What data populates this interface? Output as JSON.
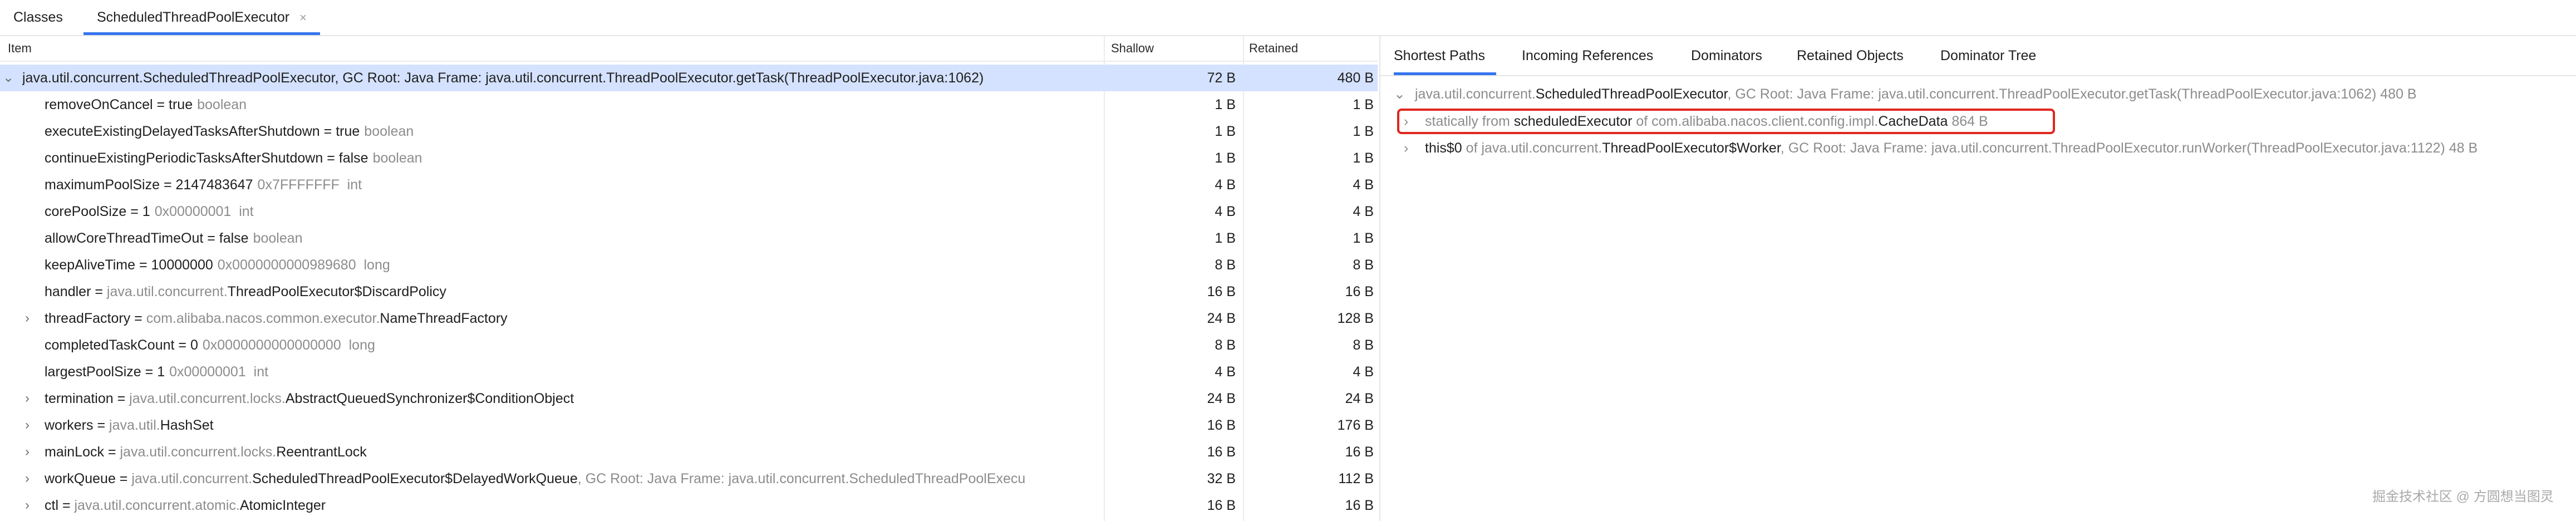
{
  "tabs": [
    {
      "label": "Classes"
    },
    {
      "label": "ScheduledThreadPoolExecutor",
      "close": "×"
    }
  ],
  "table": {
    "headers": {
      "item": "Item",
      "shallow": "Shallow",
      "retained": "Retained"
    }
  },
  "root_row": {
    "chevron": "⌄",
    "text": "java.util.concurrent.ScheduledThreadPoolExecutor, GC Root: Java Frame: java.util.concurrent.ThreadPoolExecutor.getTask(ThreadPoolExecutor.java:1062)",
    "shallow": "72 B",
    "retained": "480 B"
  },
  "fields": [
    {
      "name": "removeOnCancel = true",
      "pkg": "",
      "cls": "",
      "suffix": "boolean",
      "shallow": "1 B",
      "retained": "1 B",
      "expandable": false
    },
    {
      "name": "executeExistingDelayedTasksAfterShutdown = true",
      "pkg": "",
      "cls": "",
      "suffix": "boolean",
      "shallow": "1 B",
      "retained": "1 B",
      "expandable": false
    },
    {
      "name": "continueExistingPeriodicTasksAfterShutdown = false",
      "pkg": "",
      "cls": "",
      "suffix": "boolean",
      "shallow": "1 B",
      "retained": "1 B",
      "expandable": false
    },
    {
      "name": "maximumPoolSize = 2147483647",
      "pkg": "",
      "cls": "",
      "suffix": "0x7FFFFFFF  int",
      "shallow": "4 B",
      "retained": "4 B",
      "expandable": false
    },
    {
      "name": "corePoolSize = 1",
      "pkg": "",
      "cls": "",
      "suffix": "0x00000001  int",
      "shallow": "4 B",
      "retained": "4 B",
      "expandable": false
    },
    {
      "name": "allowCoreThreadTimeOut = false",
      "pkg": "",
      "cls": "",
      "suffix": "boolean",
      "shallow": "1 B",
      "retained": "1 B",
      "expandable": false
    },
    {
      "name": "keepAliveTime = 10000000",
      "pkg": "",
      "cls": "",
      "suffix": "0x0000000000989680  long",
      "shallow": "8 B",
      "retained": "8 B",
      "expandable": false
    },
    {
      "name": "handler = ",
      "pkg": "java.util.concurrent.",
      "cls": "ThreadPoolExecutor$DiscardPolicy",
      "suffix": "",
      "shallow": "16 B",
      "retained": "16 B",
      "expandable": false
    },
    {
      "name": "threadFactory = ",
      "pkg": "com.alibaba.nacos.common.executor.",
      "cls": "NameThreadFactory",
      "suffix": "",
      "shallow": "24 B",
      "retained": "128 B",
      "expandable": true
    },
    {
      "name": "completedTaskCount = 0",
      "pkg": "",
      "cls": "",
      "suffix": "0x0000000000000000  long",
      "shallow": "8 B",
      "retained": "8 B",
      "expandable": false
    },
    {
      "name": "largestPoolSize = 1",
      "pkg": "",
      "cls": "",
      "suffix": "0x00000001  int",
      "shallow": "4 B",
      "retained": "4 B",
      "expandable": false
    },
    {
      "name": "termination = ",
      "pkg": "java.util.concurrent.locks.",
      "cls": "AbstractQueuedSynchronizer$ConditionObject",
      "suffix": "",
      "shallow": "24 B",
      "retained": "24 B",
      "expandable": true
    },
    {
      "name": "workers = ",
      "pkg": "java.util.",
      "cls": "HashSet",
      "suffix": "",
      "shallow": "16 B",
      "retained": "176 B",
      "expandable": true
    },
    {
      "name": "mainLock = ",
      "pkg": "java.util.concurrent.locks.",
      "cls": "ReentrantLock",
      "suffix": "",
      "shallow": "16 B",
      "retained": "16 B",
      "expandable": true
    },
    {
      "name": "workQueue = ",
      "pkg": "java.util.concurrent.",
      "cls": "ScheduledThreadPoolExecutor$DelayedWorkQueue",
      "suffix": ", GC Root: Java Frame: java.util.concurrent.ScheduledThreadPoolExecu",
      "shallow": "32 B",
      "retained": "112 B",
      "expandable": true
    },
    {
      "name": "ctl = ",
      "pkg": "java.util.concurrent.atomic.",
      "cls": "AtomicInteger",
      "suffix": "",
      "shallow": "16 B",
      "retained": "16 B",
      "expandable": true
    }
  ],
  "right_tabs": [
    {
      "label": "Shortest Paths"
    },
    {
      "label": "Incoming References"
    },
    {
      "label": "Dominators"
    },
    {
      "label": "Retained Objects"
    },
    {
      "label": "Dominator Tree"
    }
  ],
  "paths": {
    "root": {
      "chevron": "⌄",
      "pkg": "java.util.concurrent.",
      "cls": "ScheduledThreadPoolExecutor",
      "rest": ", GC Root: Java Frame: java.util.concurrent.ThreadPoolExecutor.getTask(ThreadPoolExecutor.java:1062)  480 B"
    },
    "static_ref": {
      "chevron": "›",
      "prefix": "statically from",
      "field": "scheduledExecutor",
      "of": "of com.alibaba.nacos.client.config.impl.",
      "cls": "CacheData",
      "size": "864 B"
    },
    "worker_ref": {
      "chevron": "›",
      "field": "this$0",
      "of": "of java.util.concurrent.",
      "cls": "ThreadPoolExecutor$Worker",
      "rest": ", GC Root: Java Frame: java.util.concurrent.ThreadPoolExecutor.runWorker(ThreadPoolExecutor.java:1122)  48 B"
    }
  },
  "watermark": "掘金技术社区 @ 方圆想当图灵",
  "colors": {
    "accent": "#3574f0",
    "selection": "#d4e2ff",
    "highlight": "#e0261f",
    "muted": "#8c8c8c"
  }
}
